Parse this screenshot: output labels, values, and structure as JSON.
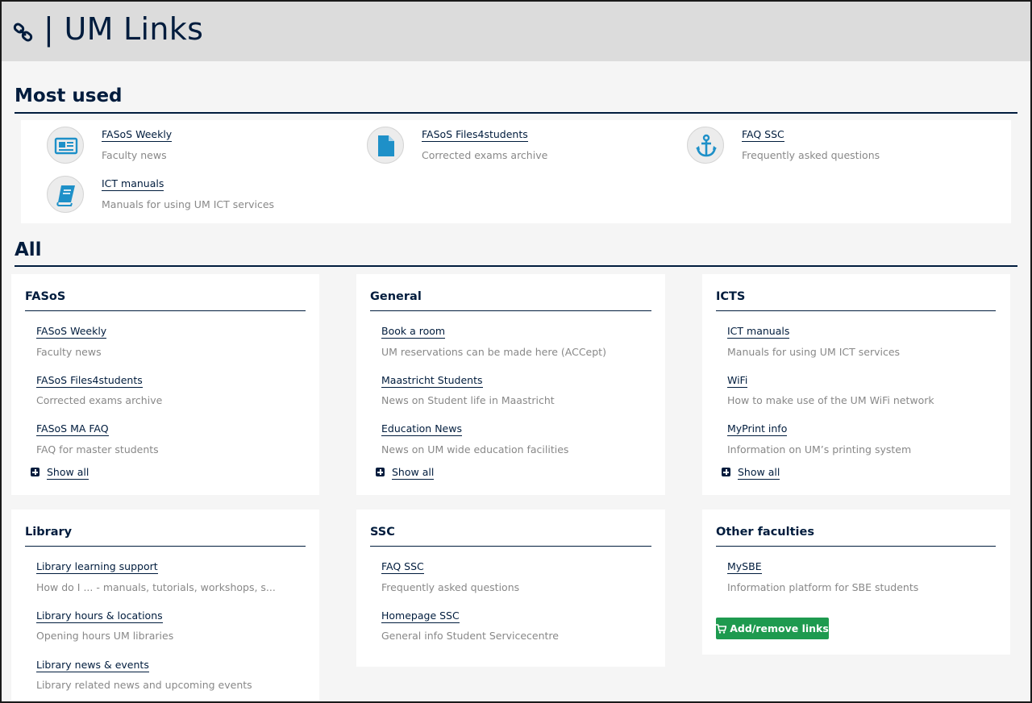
{
  "header": {
    "title": "| UM Links",
    "icon": "link-icon"
  },
  "most_used": {
    "title": "Most used",
    "items": [
      {
        "label": "FASoS Weekly",
        "desc": "Faculty news",
        "icon": "newspaper-icon"
      },
      {
        "label": "FASoS Files4students",
        "desc": "Corrected exams archive",
        "icon": "file-icon"
      },
      {
        "label": "FAQ SSC",
        "desc": "Frequently asked questions",
        "icon": "anchor-icon"
      },
      {
        "label": "ICT manuals",
        "desc": "Manuals for using UM ICT services",
        "icon": "book-icon"
      }
    ]
  },
  "all": {
    "title": "All",
    "show_all": "Show all",
    "add_button": "Add/remove links",
    "colors": {
      "accent": "#001c3d",
      "button": "#1e9a4f",
      "muted": "#888888"
    },
    "cards": [
      {
        "title": "FASoS",
        "links": [
          {
            "label": "FASoS Weekly",
            "desc": "Faculty news"
          },
          {
            "label": "FASoS Files4students",
            "desc": "Corrected exams archive"
          },
          {
            "label": "FASoS MA FAQ",
            "desc": "FAQ for master students"
          }
        ]
      },
      {
        "title": "General",
        "links": [
          {
            "label": "Book a room",
            "desc": "UM reservations can be made here (ACCept)"
          },
          {
            "label": "Maastricht Students",
            "desc": "News on Student life in Maastricht"
          },
          {
            "label": "Education News",
            "desc": "News on UM wide education facilities"
          }
        ]
      },
      {
        "title": "ICTS",
        "links": [
          {
            "label": "ICT manuals",
            "desc": "Manuals for using UM ICT services"
          },
          {
            "label": "WiFi",
            "desc": "How to make use of the UM WiFi network"
          },
          {
            "label": "MyPrint info",
            "desc": "Information on UM’s printing system"
          }
        ]
      },
      {
        "title": "Library",
        "links": [
          {
            "label": "Library learning support",
            "desc": "How do I ... - manuals, tutorials, workshops, s..."
          },
          {
            "label": "Library hours & locations",
            "desc": "Opening hours UM libraries"
          },
          {
            "label": "Library news & events",
            "desc": "Library related news and upcoming events"
          }
        ]
      },
      {
        "title": "SSC",
        "links": [
          {
            "label": "FAQ SSC",
            "desc": "Frequently asked questions"
          },
          {
            "label": "Homepage SSC",
            "desc": "General info Student Servicecentre"
          }
        ]
      },
      {
        "title": "Other faculties",
        "links": [
          {
            "label": "MySBE",
            "desc": "Information platform for SBE students"
          }
        ]
      }
    ]
  }
}
